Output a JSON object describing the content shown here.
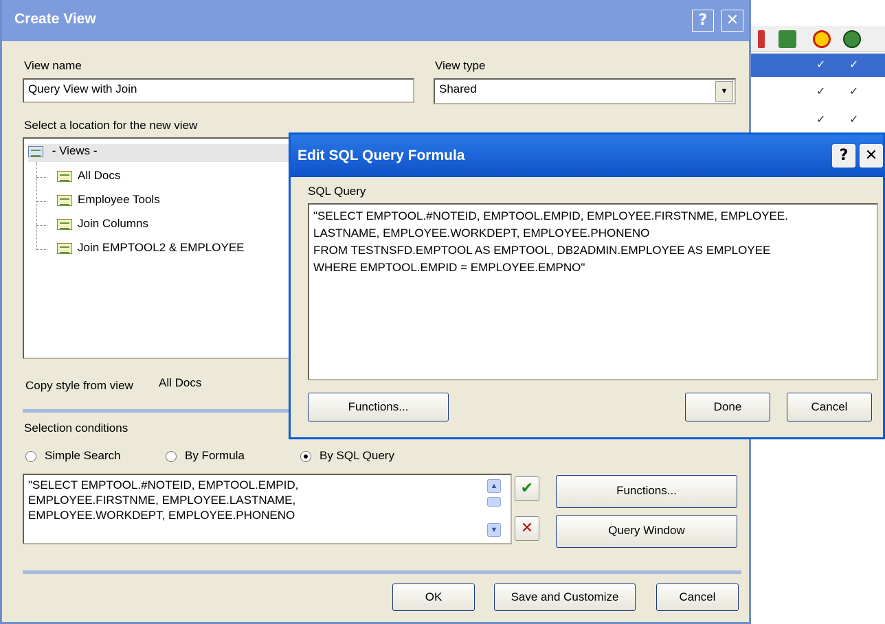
{
  "create_view": {
    "title": "Create View",
    "help_button": "?",
    "close_button": "✕",
    "view_name_label": "View name",
    "view_name_value": "Query View with Join",
    "view_type_label": "View type",
    "view_type_value": "Shared",
    "location_label": "Select a location for the new view",
    "tree": {
      "root": "- Views -",
      "items": [
        "All Docs",
        "Employee Tools",
        "Join Columns",
        "Join EMPTOOL2 & EMPLOYEE"
      ]
    },
    "copy_style_label": "Copy style from view",
    "copy_style_value": "All Docs",
    "selection_label": "Selection conditions",
    "radios": [
      "Simple Search",
      "By Formula",
      "By SQL Query"
    ],
    "selected_radio": "By SQL Query",
    "condition_text": "\"SELECT EMPTOOL.#NOTEID, EMPTOOL.EMPID,\nEMPLOYEE.FIRSTNME, EMPLOYEE.LASTNAME,\nEMPLOYEE.WORKDEPT, EMPLOYEE.PHONENO",
    "functions_button": "Functions...",
    "query_window_button": "Query Window",
    "ok_button": "OK",
    "save_customize_button": "Save and Customize",
    "cancel_button": "Cancel"
  },
  "edit_sql": {
    "title": "Edit SQL Query Formula",
    "help_button": "?",
    "close_button": "✕",
    "query_label": "SQL Query",
    "query_text": "\"SELECT EMPTOOL.#NOTEID, EMPTOOL.EMPID, EMPLOYEE.FIRSTNME, EMPLOYEE.\nLASTNAME, EMPLOYEE.WORKDEPT, EMPLOYEE.PHONENO\nFROM TESTNSFD.EMPTOOL AS EMPTOOL, DB2ADMIN.EMPLOYEE AS EMPLOYEE\nWHERE EMPTOOL.EMPID = EMPLOYEE.EMPNO\"",
    "functions_button": "Functions...",
    "done_button": "Done",
    "cancel_button": "Cancel"
  },
  "background": {
    "checkmark": "✓"
  },
  "colors": {
    "accent": "#0a5bd6",
    "selected_row": "#3a6ccf"
  }
}
